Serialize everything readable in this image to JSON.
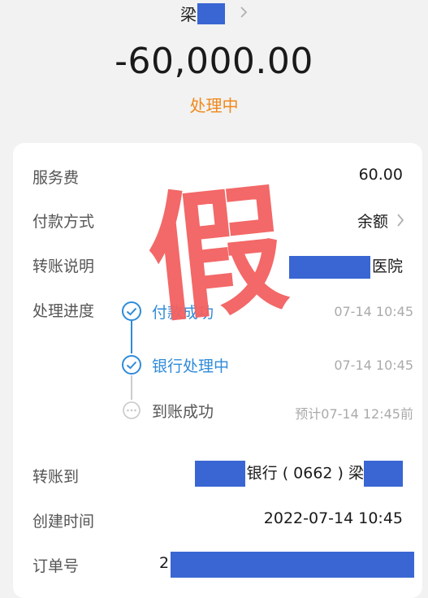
{
  "header": {
    "payee_name": "梁",
    "amount": "-60,000.00",
    "status": "处理中"
  },
  "details": {
    "fee_label": "服务费",
    "fee_value": "60.00",
    "method_label": "付款方式",
    "method_value": "余额",
    "note_label": "转账说明",
    "note_value": "医院",
    "progress_label": "处理进度",
    "steps": [
      {
        "label": "付款成功",
        "time": "07-14 10:45"
      },
      {
        "label": "银行处理中",
        "time": "07-14 10:45"
      },
      {
        "label": "到账成功",
        "time": "预计07-14 12:45前"
      }
    ],
    "to_label": "转账到",
    "to_value": "银行 ( 0662 ) 梁",
    "created_label": "创建时间",
    "created_value": "2022-07-14 10:45",
    "order_label": "订单号",
    "order_value": "2"
  },
  "stamp": {
    "text": "假",
    "color": "#f26060"
  },
  "colors": {
    "accent_blue": "#2f8bd8",
    "status_orange": "#f0881b",
    "redaction": "#3a66d3"
  }
}
